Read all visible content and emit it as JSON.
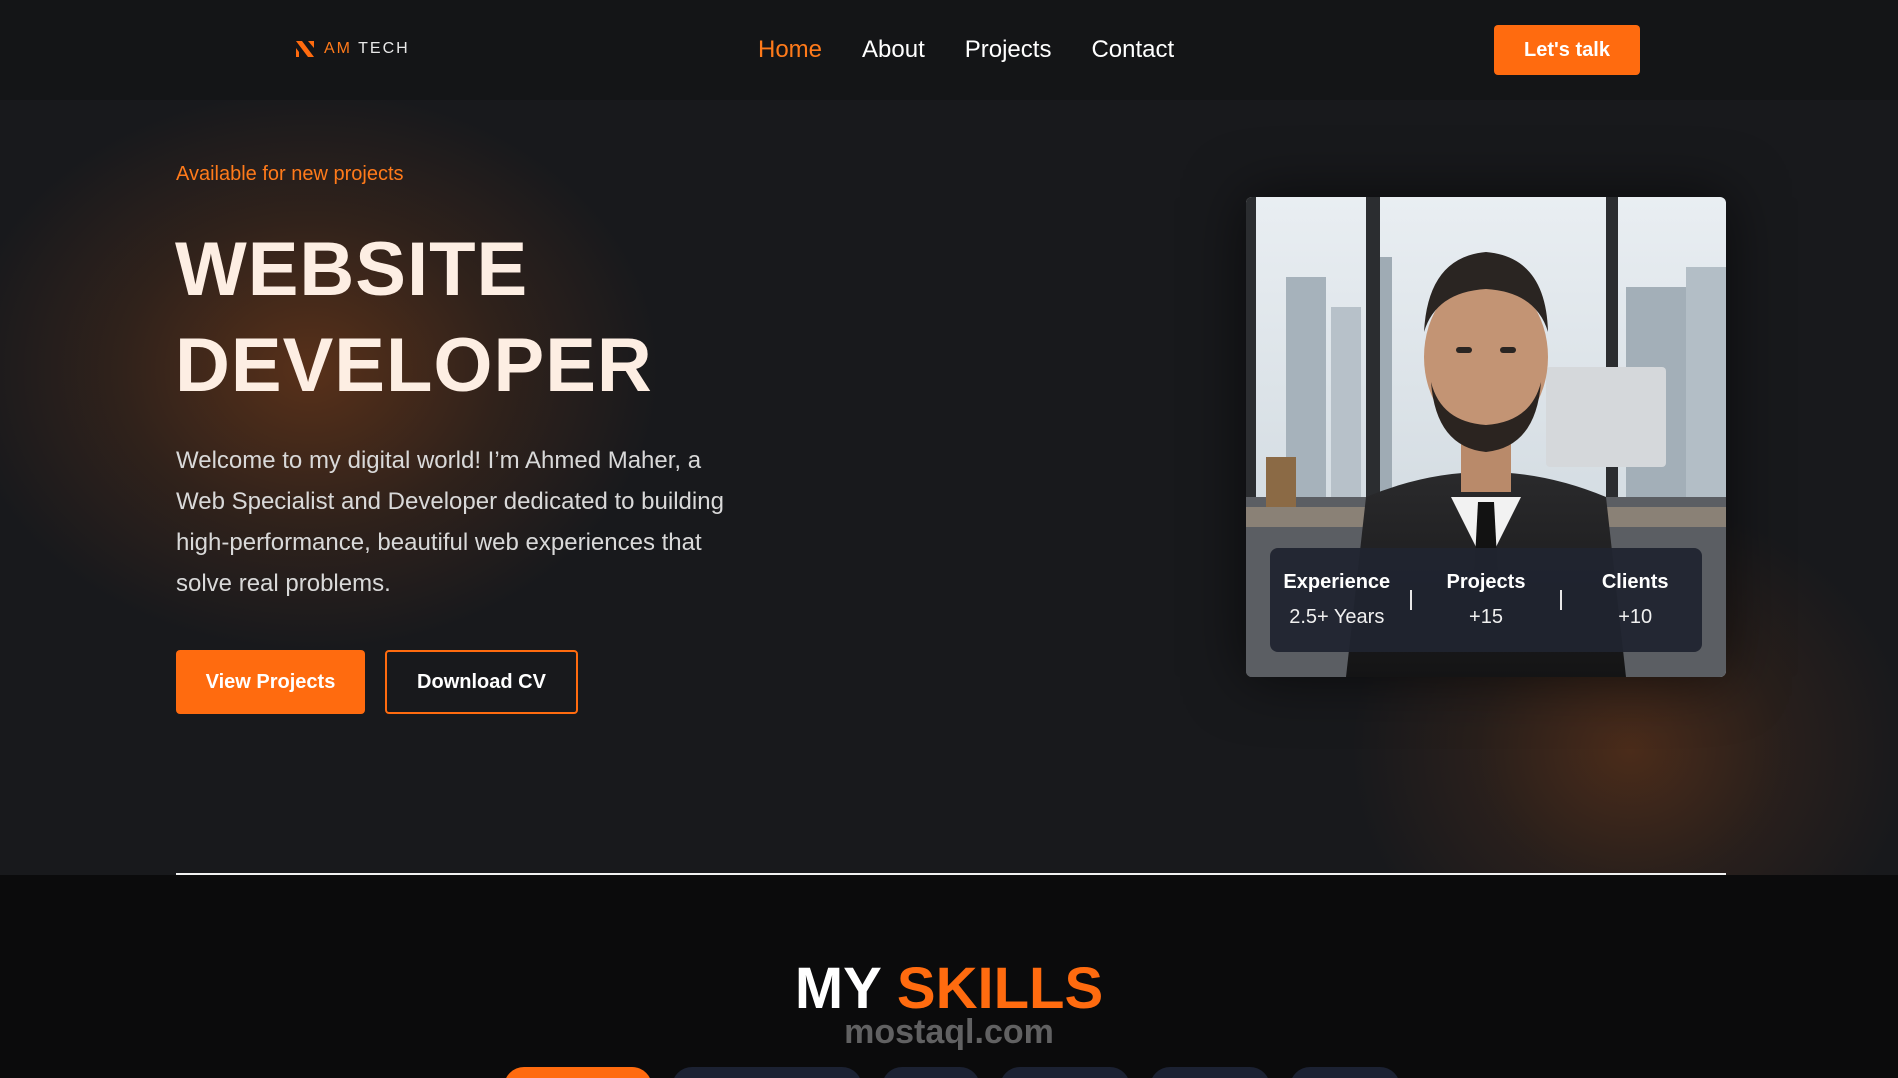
{
  "brand": {
    "am": "AM",
    "tech": "TECH"
  },
  "nav": {
    "items": [
      {
        "label": "Home"
      },
      {
        "label": "About"
      },
      {
        "label": "Projects"
      },
      {
        "label": "Contact"
      }
    ],
    "active": "Home",
    "cta": "Let's talk"
  },
  "hero": {
    "availability": "Available for new projects",
    "title_line1": "WEBSITE",
    "title_line2": "DEVELOPER",
    "description": "Welcome to my digital world! I’m Ahmed Maher, a Web Specialist and Developer dedicated to building high-performance, beautiful web experiences that solve real problems.",
    "primary_button": "View Projects",
    "secondary_button": "Download CV"
  },
  "stats": [
    {
      "label": "Experience",
      "value": "2.5+ Years"
    },
    {
      "label": "Projects",
      "value": "+15"
    },
    {
      "label": "Clients",
      "value": "+10"
    }
  ],
  "skills": {
    "title_word1": "MY",
    "title_word2": "SKILLS",
    "watermark": "mostaql.com"
  },
  "colors": {
    "accent": "#ff6b0f",
    "background": "#18191c",
    "stats_card": "#202430"
  }
}
